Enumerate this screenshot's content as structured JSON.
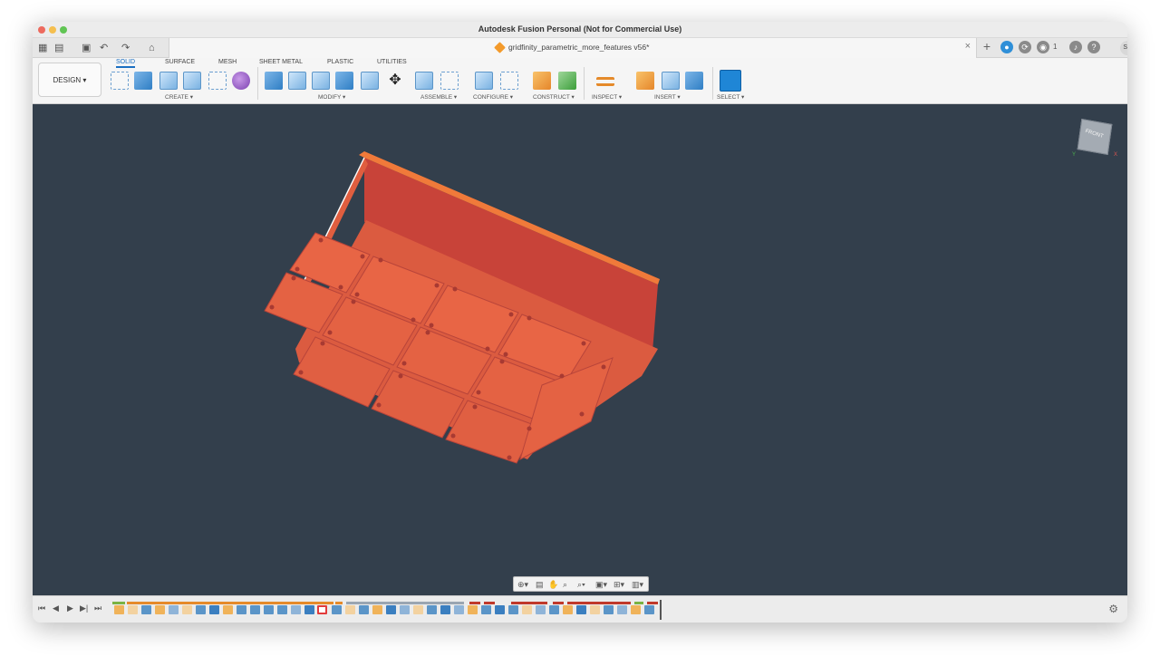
{
  "window": {
    "title": "Autodesk Fusion Personal (Not for Commercial Use)"
  },
  "tabbar": {
    "doc_title": "gridfinity_parametric_more_features v56*",
    "close_glyph": "×",
    "notification_count": "1",
    "user_initials": "SS"
  },
  "toolbar": {
    "workspace": "DESIGN ▾",
    "tabs": [
      "SOLID",
      "SURFACE",
      "MESH",
      "SHEET METAL",
      "PLASTIC",
      "UTILITIES"
    ],
    "active_tab": "SOLID",
    "groups": [
      "CREATE ▾",
      "MODIFY ▾",
      "ASSEMBLE ▾",
      "CONFIGURE ▾",
      "CONSTRUCT ▾",
      "INSPECT ▾",
      "INSERT ▾",
      "SELECT ▾"
    ]
  },
  "viewcube": {
    "face_label": "FRONT",
    "axis_x": "X",
    "axis_y": "Y"
  },
  "colors": {
    "viewport_bg": "#333f4c",
    "model_face": "#d9573f",
    "model_edge": "#f07a3a",
    "accent": "#1b6fc2"
  },
  "icons": {
    "tabbar": [
      "grid-icon",
      "file-icon",
      "save-icon",
      "undo-icon",
      "redo-icon",
      "home-icon"
    ],
    "nav": [
      "orbit-icon",
      "look-at-icon",
      "pan-icon",
      "zoom-icon",
      "zoom-window-icon",
      "display-icon",
      "grid-icon",
      "viewports-icon"
    ],
    "timeline": [
      "first-icon",
      "prev-icon",
      "play-icon",
      "next-icon",
      "last-icon"
    ]
  }
}
